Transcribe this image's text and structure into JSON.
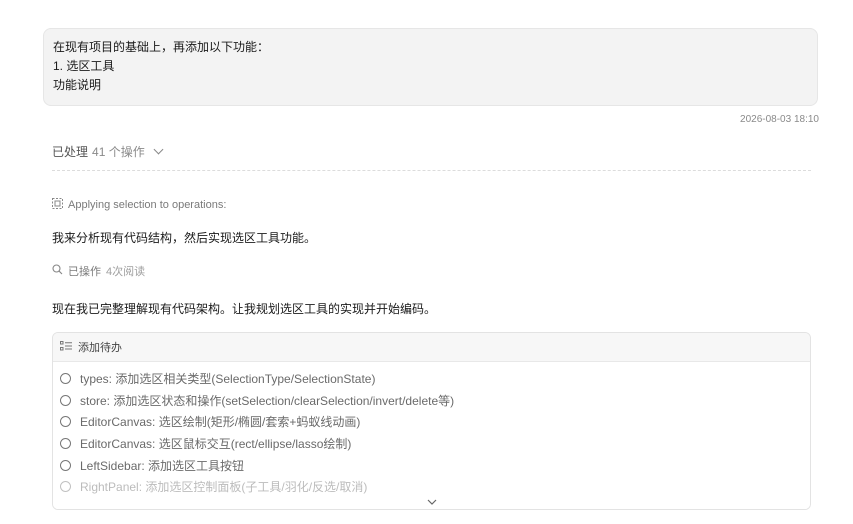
{
  "user_message": {
    "lines": [
      "在现有项目的基础上，再添加以下功能：",
      "1. 选区工具",
      "功能说明"
    ]
  },
  "timestamp": "2026-08-03 18:10",
  "processed": {
    "label": "已处理",
    "count": "41 个操作"
  },
  "applying": "Applying selection to operations:",
  "assistant_line1": "我来分析现有代码结构，然后实现选区工具功能。",
  "operations": {
    "label": "已操作",
    "detail": "4次阅读"
  },
  "assistant_line2": "现在我已完整理解现有代码架构。让我规划选区工具的实现并开始编码。",
  "todo": {
    "title": "添加待办",
    "items": [
      "types: 添加选区相关类型(SelectionType/SelectionState)",
      "store: 添加选区状态和操作(setSelection/clearSelection/invert/delete等)",
      "EditorCanvas: 选区绘制(矩形/椭圆/套索+蚂蚁线动画)",
      "EditorCanvas: 选区鼠标交互(rect/ellipse/lasso绘制)",
      "LeftSidebar: 添加选区工具按钮",
      "RightPanel: 添加选区控制面板(子工具/羽化/反选/取消)"
    ]
  }
}
